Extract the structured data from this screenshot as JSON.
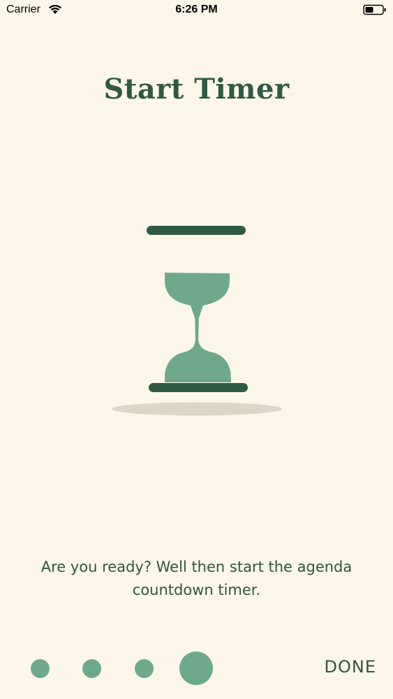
{
  "status_bar": {
    "carrier": "Carrier",
    "time": "6:26 PM",
    "icons": [
      "wifi-icon",
      "battery-icon"
    ]
  },
  "screen": {
    "title": "Start Timer",
    "illustration": "hourglass-icon",
    "description_line1": "Are you ready? Well then start the agenda",
    "description_line2": "countdown timer."
  },
  "pager": {
    "page_count": 4,
    "current_page": 4
  },
  "actions": {
    "done_label": "DONE"
  },
  "colors": {
    "background": "#fdf7ea",
    "accent": "#6ea98c",
    "dark_green": "#2f5640"
  }
}
